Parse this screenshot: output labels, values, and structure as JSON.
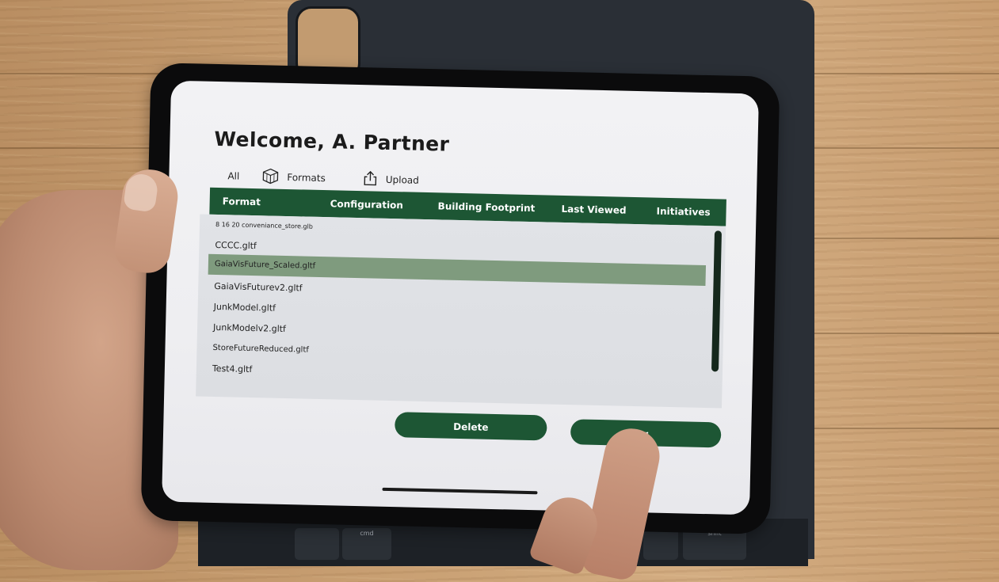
{
  "app": {
    "title": "Welcome, A. Partner"
  },
  "tabs": [
    {
      "label": "All"
    },
    {
      "label": "Formats",
      "icon": "cube-icon"
    },
    {
      "label": "Upload",
      "icon": "upload-icon"
    }
  ],
  "table": {
    "headers": [
      "Format",
      "Configuration",
      "Building Footprint",
      "Last Viewed",
      "Initiatives"
    ],
    "rows": [
      "8 16 20 conveniance_store.glb",
      "CCCC.gltf",
      "GaiaVisFuture_Scaled.gltf",
      "GaiaVisFuturev2.gltf",
      "JunkModel.gltf",
      "JunkModelv2.gltf",
      "StoreFutureReduced.gltf",
      "Test4.gltf"
    ],
    "selected_row": "GaiaVisFuture_Scaled.gltf"
  },
  "buttons": {
    "delete": "Delete",
    "second": "er"
  },
  "keyboard": {
    "cmd": "cmd",
    "shift": "shift"
  },
  "colors": {
    "accent": "#1d5634",
    "selected_row": "#7f9b7e"
  }
}
